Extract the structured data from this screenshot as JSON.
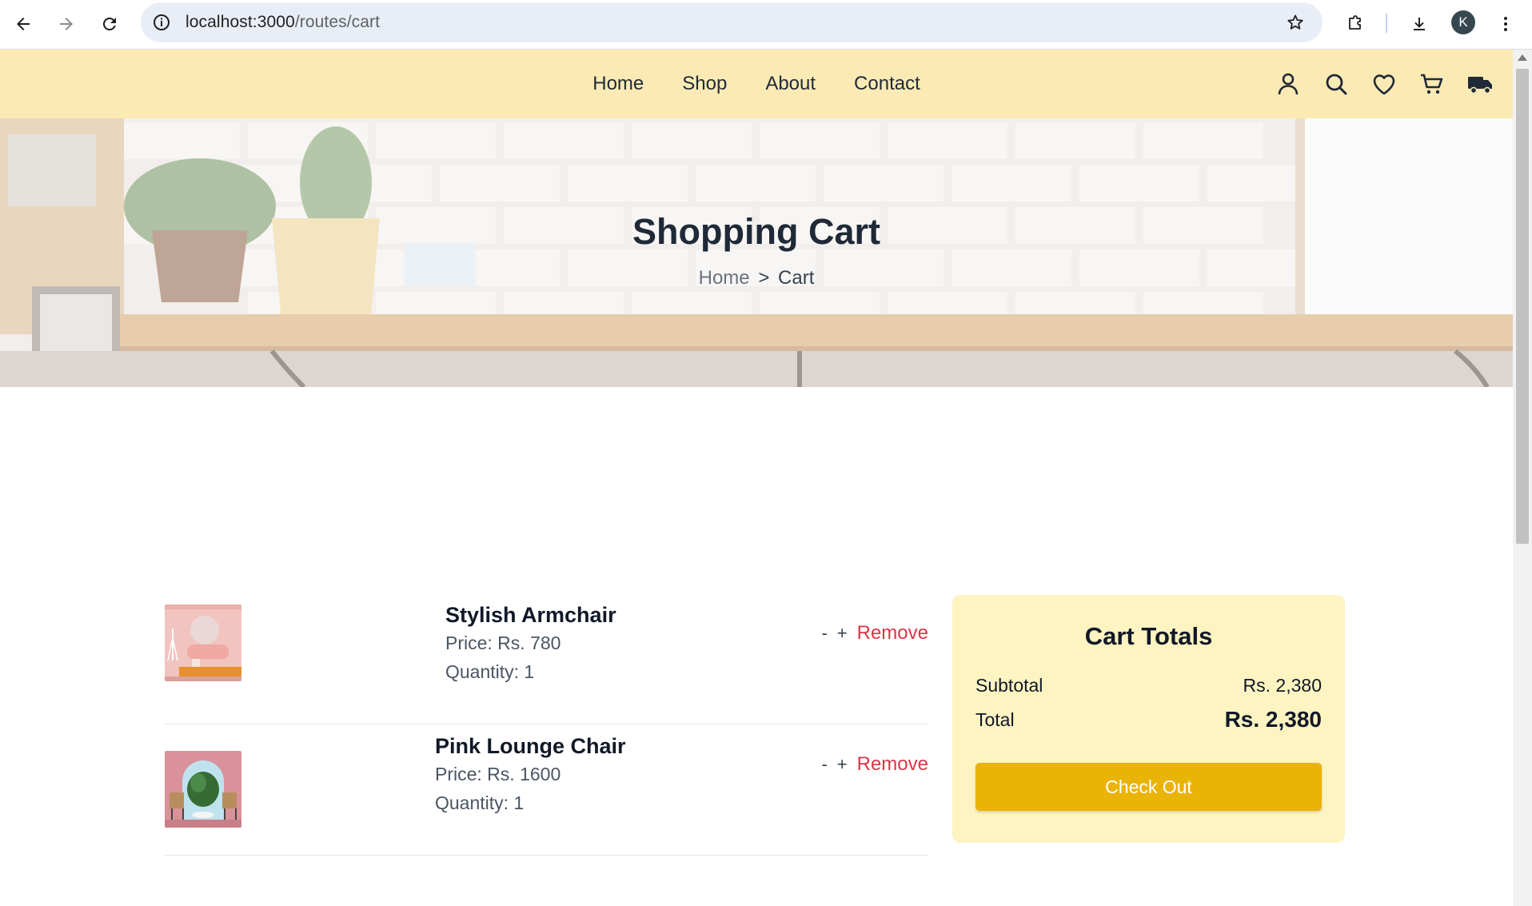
{
  "browser": {
    "url_host": "localhost:3000",
    "url_path": "/routes/cart",
    "profile_initial": "K"
  },
  "header": {
    "nav": [
      "Home",
      "Shop",
      "About",
      "Contact"
    ],
    "icons": [
      "user-icon",
      "search-icon",
      "heart-icon",
      "cart-icon",
      "truck-icon"
    ]
  },
  "hero": {
    "title": "Shopping Cart",
    "breadcrumb_home": "Home",
    "breadcrumb_sep": ">",
    "breadcrumb_current": "Cart"
  },
  "cart": {
    "items": [
      {
        "name": "Stylish Armchair",
        "price": "Price: Rs. 780",
        "quantity": "Quantity: 1",
        "minus": "-",
        "plus": "+",
        "remove": "Remove"
      },
      {
        "name": "Pink Lounge Chair",
        "price": "Price: Rs. 1600",
        "quantity": "Quantity: 1",
        "minus": "-",
        "plus": "+",
        "remove": "Remove"
      }
    ]
  },
  "totals": {
    "title": "Cart Totals",
    "subtotal_label": "Subtotal",
    "subtotal_value": "Rs. 2,380",
    "total_label": "Total",
    "total_value": "Rs. 2,380",
    "checkout_label": "Check Out"
  },
  "colors": {
    "header_bg": "#fbeab4",
    "totals_bg": "#fdf4c2",
    "checkout_bg": "#eab308",
    "remove": "#dc3545"
  }
}
